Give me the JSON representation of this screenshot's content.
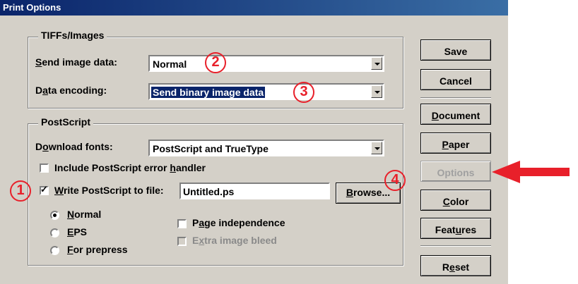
{
  "window": {
    "title": "Print Options"
  },
  "tiffs_group": {
    "title": "TIFFs/Images",
    "send_image_data": {
      "label": "Send image data:",
      "value": "Normal"
    },
    "data_encoding": {
      "label": "Data encoding:",
      "value": "Send binary image data"
    }
  },
  "postscript_group": {
    "title": "PostScript",
    "download_fonts": {
      "label": "Download fonts:",
      "value": "PostScript and TrueType"
    },
    "include_error_handler": {
      "label": "Include PostScript error handler",
      "checked": false
    },
    "write_to_file": {
      "label": "Write PostScript to file:",
      "checked": true,
      "value": "Untitled.ps"
    },
    "browse_label": "Browse...",
    "radios": [
      {
        "label": "Normal",
        "selected": true
      },
      {
        "label": "EPS",
        "selected": false
      },
      {
        "label": "For prepress",
        "selected": false
      }
    ],
    "page_independence": {
      "label": "Page independence",
      "checked": false
    },
    "extra_image_bleed": {
      "label": "Extra image bleed",
      "checked": false,
      "disabled": true
    }
  },
  "buttons": {
    "save": "Save",
    "cancel": "Cancel",
    "document": "Document",
    "paper": "Paper",
    "options": "Options",
    "color": "Color",
    "features": "Features",
    "reset": "Reset"
  },
  "annotations": {
    "one": "1",
    "two": "2",
    "three": "3",
    "four": "4"
  },
  "colors": {
    "annotation": "#e8202a",
    "titlebar": "#0a246a",
    "dialog": "#d4d0c8"
  }
}
